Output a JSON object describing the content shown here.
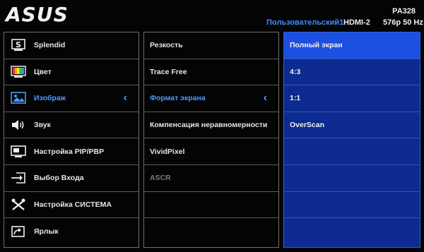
{
  "header": {
    "logo": "ASUS",
    "model": "PA328",
    "profile": "Пользовательский1",
    "input": "HDMI-2",
    "resolution": "576p 50 Hz"
  },
  "main_menu": [
    {
      "label": "Splendid",
      "icon": "splendid-s-icon"
    },
    {
      "label": "Цвет",
      "icon": "color-bars-icon"
    },
    {
      "label": "Изображ",
      "icon": "image-icon",
      "selected": true
    },
    {
      "label": "Звук",
      "icon": "speaker-icon"
    },
    {
      "label": "Настройка PIP/PBP",
      "icon": "pip-monitor-icon"
    },
    {
      "label": "Выбор Входа",
      "icon": "input-select-icon"
    },
    {
      "label": "Настройка СИСТЕМА",
      "icon": "tools-icon"
    },
    {
      "label": "Ярлык",
      "icon": "shortcut-icon"
    }
  ],
  "submenu": [
    {
      "label": "Резкость"
    },
    {
      "label": "Trace Free"
    },
    {
      "label": "Формат экрана",
      "selected": true
    },
    {
      "label": "Компенсация неравномерности"
    },
    {
      "label": "VividPixel"
    },
    {
      "label": "ASCR",
      "disabled": true
    },
    {
      "label": ""
    },
    {
      "label": ""
    }
  ],
  "options": [
    {
      "label": "Полный экран",
      "highlighted": true
    },
    {
      "label": "4:3"
    },
    {
      "label": "1:1"
    },
    {
      "label": "OverScan"
    },
    {
      "label": ""
    },
    {
      "label": ""
    },
    {
      "label": ""
    },
    {
      "label": ""
    }
  ],
  "colors": {
    "accent": "#4a9bff",
    "panel_bg": "#0c2a8f",
    "highlight": "#1d4fe0"
  }
}
